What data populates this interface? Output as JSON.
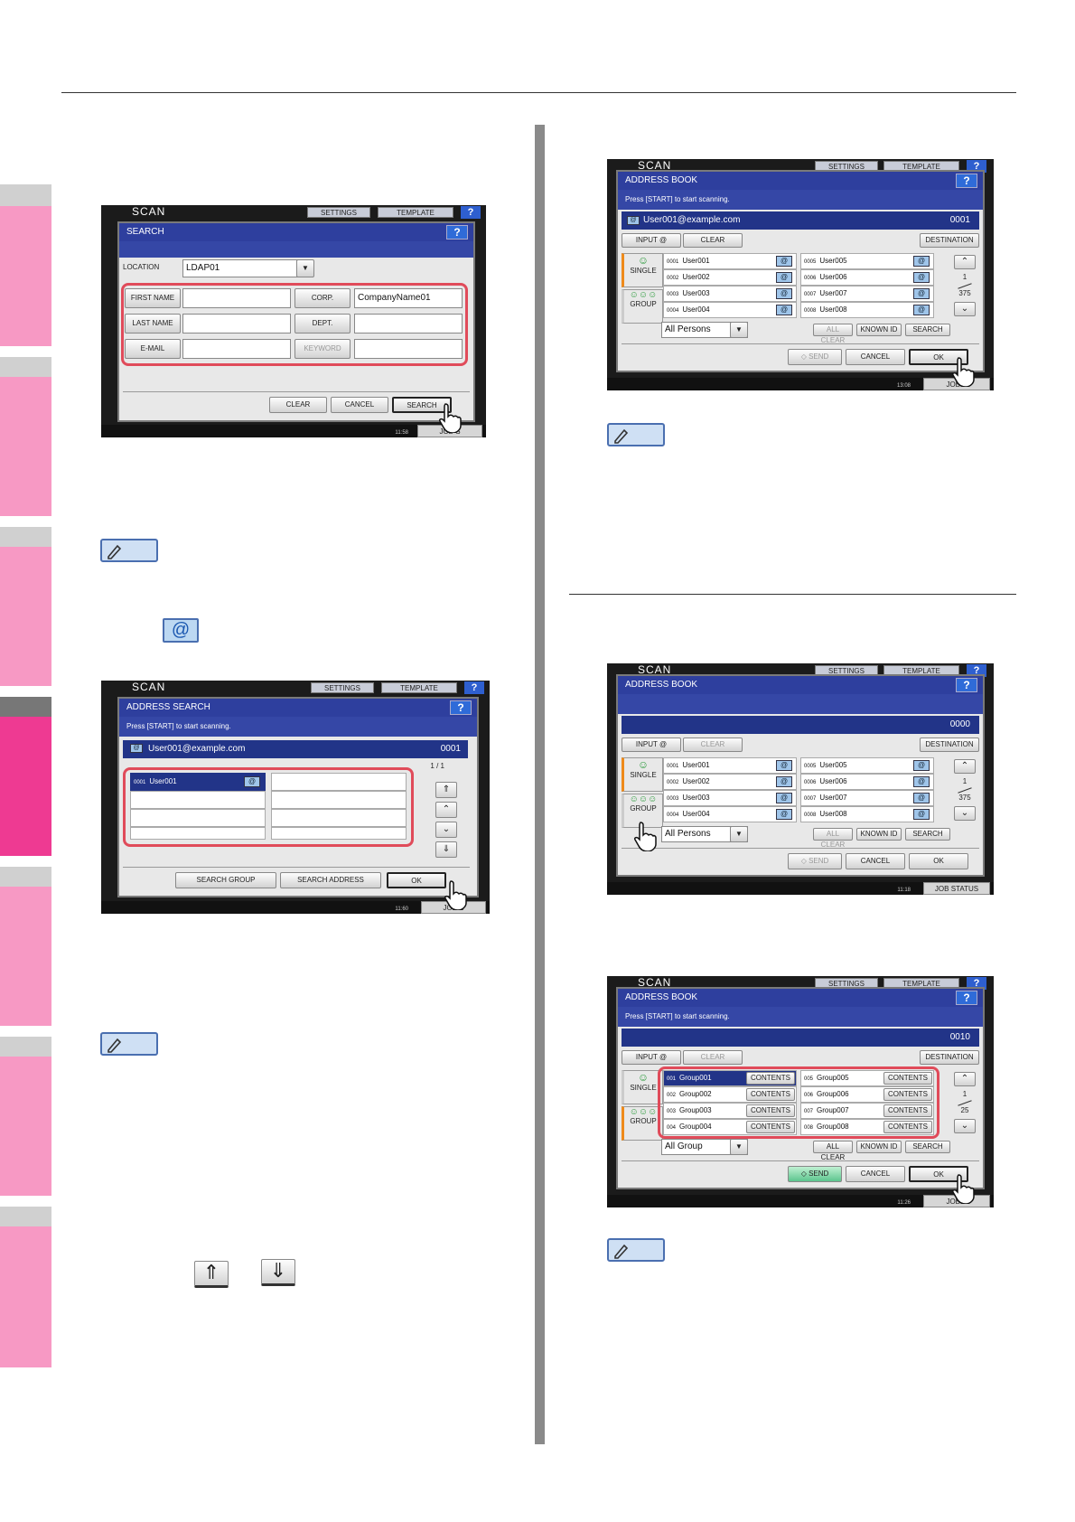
{
  "colors": {
    "accent": "#ee3a92",
    "tab": "#f799c4",
    "title_bar": "#2e3f9e",
    "highlight": "#e04b5a"
  },
  "common": {
    "scan": "SCAN",
    "settings": "SETTINGS",
    "template": "TEMPLATE",
    "help": "?",
    "job_status": "JOB STATUS",
    "job_short": "JOB S"
  },
  "s1": {
    "title": "SEARCH",
    "location_label": "LOCATION",
    "location_value": "LDAP01",
    "first_name": "FIRST NAME",
    "last_name": "LAST NAME",
    "email": "E-MAIL",
    "corp": "CORP.",
    "dept": "DEPT.",
    "keyword": "KEYWORD",
    "corp_value": "CompanyName01",
    "clear": "CLEAR",
    "cancel": "CANCEL",
    "search": "SEARCH",
    "time": "11:58"
  },
  "s2": {
    "title": "ADDRESS SEARCH",
    "press": "Press [START] to start scanning.",
    "dest": "User001@example.com",
    "count": "0001",
    "page": "1 / 1",
    "row_num": "0001",
    "row_name": "User001",
    "search_group": "SEARCH GROUP",
    "search_address": "SEARCH ADDRESS",
    "ok": "OK",
    "time": "11:60"
  },
  "s3": {
    "title": "ADDRESS BOOK",
    "press": "Press [START] to start scanning.",
    "dest": "User001@example.com",
    "count": "0001",
    "input": "INPUT @",
    "clear": "CLEAR",
    "destination": "DESTINATION",
    "single": "SINGLE",
    "group": "GROUP",
    "left": [
      {
        "n": "0001",
        "name": "User001"
      },
      {
        "n": "0002",
        "name": "User002"
      },
      {
        "n": "0003",
        "name": "User003"
      },
      {
        "n": "0004",
        "name": "User004"
      }
    ],
    "right": [
      {
        "n": "0005",
        "name": "User005"
      },
      {
        "n": "0006",
        "name": "User006"
      },
      {
        "n": "0007",
        "name": "User007"
      },
      {
        "n": "0008",
        "name": "User008"
      }
    ],
    "page_top": "1",
    "page_total": "375",
    "filter": "All Persons",
    "all_clear": "ALL CLEAR",
    "known_id": "KNOWN ID",
    "search": "SEARCH",
    "send": "SEND",
    "cancel": "CANCEL",
    "ok": "OK",
    "time": "13:08"
  },
  "s4": {
    "title": "ADDRESS BOOK",
    "count": "0000",
    "input": "INPUT @",
    "clear": "CLEAR",
    "destination": "DESTINATION",
    "single": "SINGLE",
    "group": "GROUP",
    "left": [
      {
        "n": "0001",
        "name": "User001"
      },
      {
        "n": "0002",
        "name": "User002"
      },
      {
        "n": "0003",
        "name": "User003"
      },
      {
        "n": "0004",
        "name": "User004"
      }
    ],
    "right": [
      {
        "n": "0005",
        "name": "User005"
      },
      {
        "n": "0006",
        "name": "User006"
      },
      {
        "n": "0007",
        "name": "User007"
      },
      {
        "n": "0008",
        "name": "User008"
      }
    ],
    "page_top": "1",
    "page_total": "375",
    "filter": "All Persons",
    "all_clear": "ALL CLEAR",
    "known_id": "KNOWN ID",
    "search": "SEARCH",
    "send": "SEND",
    "cancel": "CANCEL",
    "ok": "OK",
    "time": "11:18"
  },
  "s5": {
    "title": "ADDRESS BOOK",
    "press": "Press [START] to start scanning.",
    "count": "0010",
    "input": "INPUT @",
    "clear": "CLEAR",
    "destination": "DESTINATION",
    "single": "SINGLE",
    "group": "GROUP",
    "left": [
      {
        "n": "001",
        "name": "Group001"
      },
      {
        "n": "002",
        "name": "Group002"
      },
      {
        "n": "003",
        "name": "Group003"
      },
      {
        "n": "004",
        "name": "Group004"
      }
    ],
    "right": [
      {
        "n": "005",
        "name": "Group005"
      },
      {
        "n": "006",
        "name": "Group006"
      },
      {
        "n": "007",
        "name": "Group007"
      },
      {
        "n": "008",
        "name": "Group008"
      }
    ],
    "contents": "CONTENTS",
    "page_top": "1",
    "page_total": "25",
    "filter": "All Group",
    "all_clear": "ALL CLEAR",
    "known_id": "KNOWN ID",
    "search": "SEARCH",
    "send": "SEND",
    "cancel": "CANCEL",
    "ok": "OK",
    "time": "11:26"
  }
}
